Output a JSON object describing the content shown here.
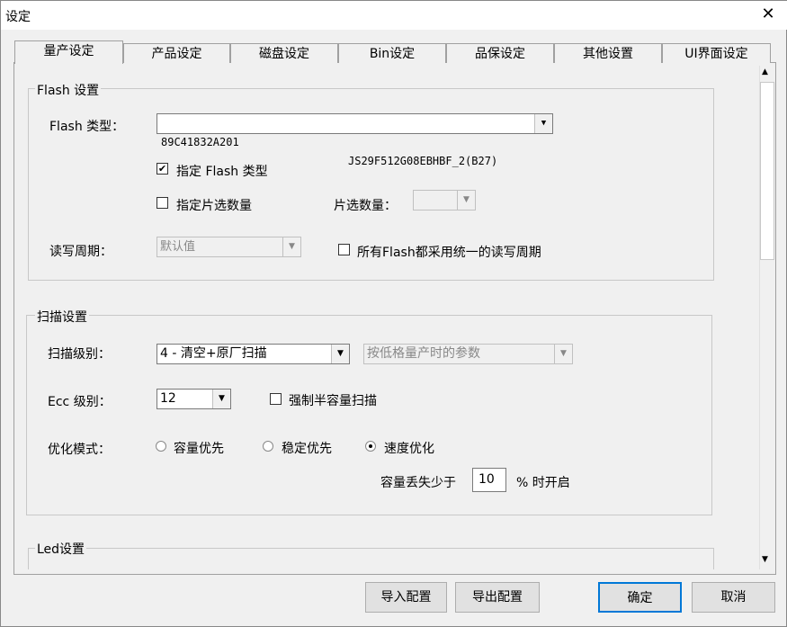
{
  "window": {
    "title": "设定",
    "close": "✕"
  },
  "tabs": [
    "量产设定",
    "产品设定",
    "磁盘设定",
    "Bin设定",
    "品保设定",
    "其他设置",
    "UI界面设定"
  ],
  "flash": {
    "group": "Flash 设置",
    "type_label": "Flash 类型：",
    "type_id": "89C41832A201",
    "type_name": "JS29F512G08EBHBF_2(B27)",
    "specify_type": "指定 Flash 类型",
    "specify_type_checked": true,
    "specify_cs": "指定片选数量",
    "specify_cs_checked": false,
    "cs_count_label": "片选数量：",
    "cs_count_value": "",
    "rw_label": "读写周期：",
    "rw_value": "默认值",
    "unify_rw": "所有Flash都采用统一的读写周期",
    "unify_rw_checked": false
  },
  "scan": {
    "group": "扫描设置",
    "level_label": "扫描级别：",
    "level_value": "4 - 清空+原厂扫描",
    "param_value": "按低格量产时的参数",
    "ecc_label": "Ecc 级别：",
    "ecc_value": "12",
    "half_scan": "强制半容量扫描",
    "half_scan_checked": false,
    "opt_label": "优化模式：",
    "opt_options": [
      "容量优先",
      "稳定优先",
      "速度优化"
    ],
    "opt_selected": "速度优化",
    "loss_prefix": "容量丢失少于",
    "loss_value": "10",
    "loss_suffix": "% 时开启"
  },
  "led": {
    "group": "Led设置"
  },
  "buttons": {
    "import": "导入配置",
    "export": "导出配置",
    "ok": "确定",
    "cancel": "取消"
  }
}
